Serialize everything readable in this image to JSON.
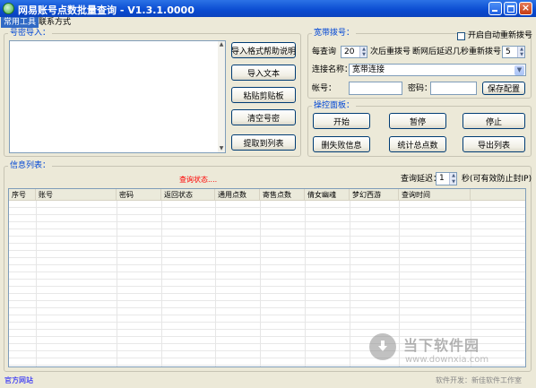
{
  "window": {
    "title": "网易账号点数批量查询 - V1.3.1.0000"
  },
  "tabs": [
    {
      "label": "常用工具",
      "active": true
    },
    {
      "label": "联系方式",
      "active": false
    }
  ],
  "import_group": {
    "label": "号密导入："
  },
  "import_buttons": [
    {
      "label": "导入格式帮助说明"
    },
    {
      "label": "导入文本"
    },
    {
      "label": "粘贴剪贴板"
    },
    {
      "label": "清空号密"
    },
    {
      "label": "提取到列表"
    }
  ],
  "broadband": {
    "label": "宽带拨号：",
    "auto_redial_label": "开启自动重新拨号",
    "every_query_label": "每查询",
    "every_query_value": "20",
    "then_redial_label": "次后重拨号",
    "delay_label": "断网后延迟几秒重新拨号：",
    "delay_value": "5",
    "connection_name_label": "连接名称：",
    "connection_name_value": "宽带连接",
    "account_label": "帐号：",
    "account_value": "",
    "password_label": "密码：",
    "password_value": "",
    "save_label": "保存配置"
  },
  "control_panel": {
    "label": "操控面板：",
    "buttons": [
      {
        "label": "开始"
      },
      {
        "label": "暂停"
      },
      {
        "label": "停止"
      },
      {
        "label": "删失败信息"
      },
      {
        "label": "统计总点数"
      },
      {
        "label": "导出列表"
      }
    ]
  },
  "info_list": {
    "label": "信息列表：",
    "status_text": "查询状态....",
    "status_color": "#ff0000",
    "delay_label": "查询延迟：",
    "delay_value": "1",
    "delay_suffix": "秒(可有效防止封IP)",
    "columns": [
      "序号",
      "账号",
      "密码",
      "返回状态",
      "通用点数",
      "寄售点数",
      "倩女幽魂",
      "梦幻西游",
      "查询时间"
    ]
  },
  "footer": {
    "link": "官方网站",
    "credit": "软件开发：新佳软件工作室"
  },
  "watermark": {
    "title": "当下软件园",
    "url": "www.downxia.com"
  }
}
